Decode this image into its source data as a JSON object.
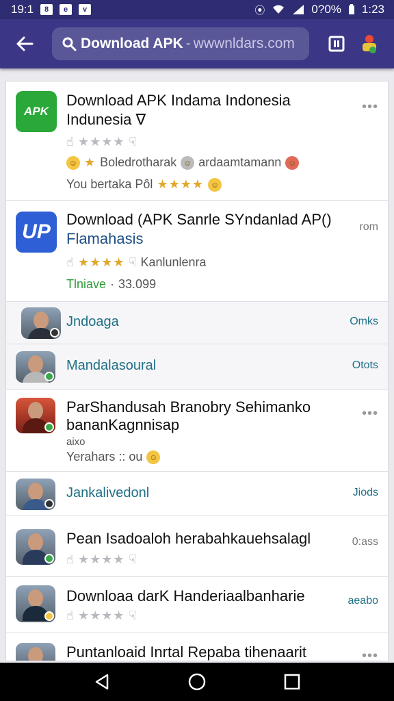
{
  "status_bar": {
    "time_left": "19:1",
    "box1": "8",
    "box2": "e",
    "box3": "v",
    "right_glyph": "⦿",
    "battery_text": "0?0%",
    "time_right": "1:23"
  },
  "app_bar": {
    "search_icon": "search-icon",
    "search_query": "Download APK",
    "search_separator": "-",
    "search_domain": "wwwnldars.com",
    "toolbar_icon": "app-switch-icon"
  },
  "results": [
    {
      "title_line1": "Download APK Indama Indonesia",
      "title_line2": "Indunesia ∇",
      "meta": "Boledrotharak",
      "meta2": "ardaamtamann",
      "meta3": "You bertaka Pôl",
      "dots": "•••",
      "icon_text": "APK",
      "icon_color": "#2aa83a"
    },
    {
      "title_line1": "Download (APK Sanrle SYndanlad AP()",
      "title_line2": "Flamahasis",
      "meta": "Kanlunlenra",
      "price": "Tlniave",
      "price_value": "33.099",
      "right": "rom",
      "icon_text": "UP",
      "icon_color": "#2e5fd4"
    },
    {
      "title": "Jndoaga",
      "right": "Omks"
    },
    {
      "title": "Mandalasoural",
      "right": "Otots"
    },
    {
      "title_line1": "ParShandusah Branobry Sehimanko",
      "title_line2": "bananKagnnisap",
      "line3": "aixo",
      "line4": "Yerahars :: ou",
      "right": "•••"
    },
    {
      "title": "Jankalivedonl",
      "right": "Jiods"
    },
    {
      "title": "Pean Isadoaloh herabahkauehsalagl",
      "right": "0:ass"
    },
    {
      "title": "Downloaa darK Handeriaalbanharie",
      "right": "aeabo"
    },
    {
      "title": "Puntanloaid Inrtal Repaba tihenaarit",
      "right": "•••"
    }
  ],
  "nav_bar": {
    "back_icon": "nav-back-icon",
    "home_icon": "nav-home-icon",
    "recents_icon": "nav-recents-icon"
  }
}
